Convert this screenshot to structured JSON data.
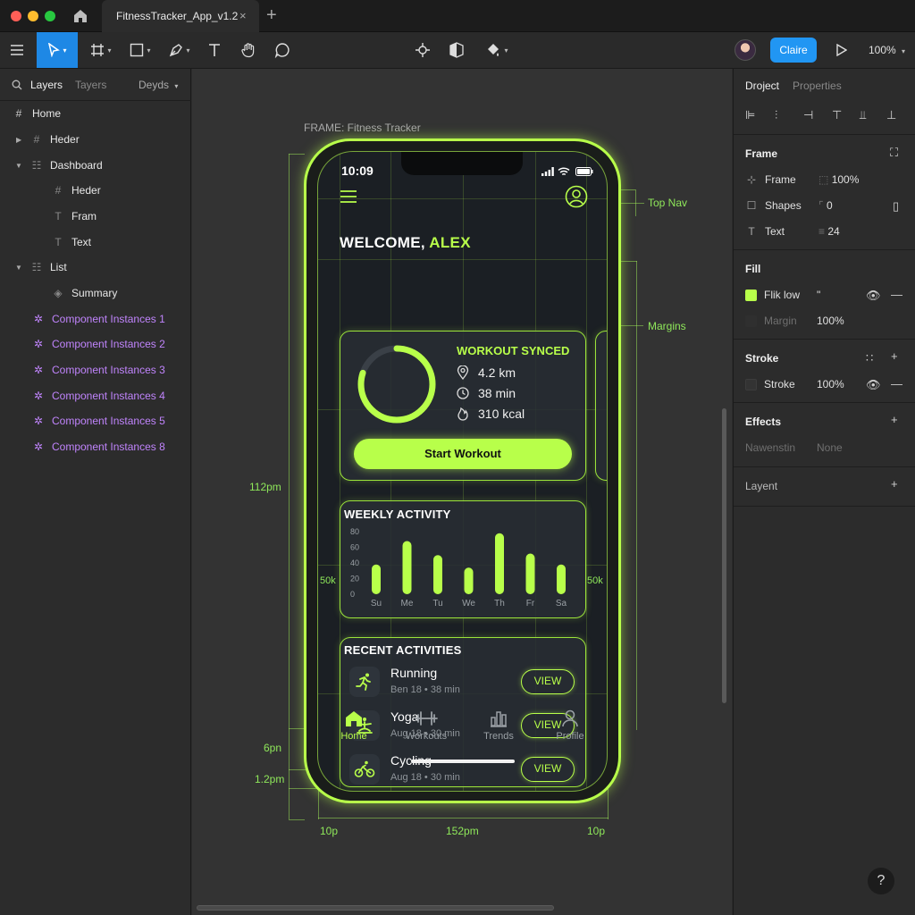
{
  "titlebar": {
    "tab_title": "FitnessTracker_App_v1.2",
    "close": "×",
    "plus": "+",
    "traffic_colors": [
      "#ff5f57",
      "#febc2e",
      "#28c840"
    ]
  },
  "toolbar": {
    "share_label": "Claire",
    "zoom": "100%",
    "icons": [
      "menu-icon",
      "move-tool-icon",
      "frame-tool-icon",
      "shape-tool-icon",
      "pen-tool-icon",
      "text-tool-icon",
      "hand-tool-icon",
      "comment-tool-icon",
      "component-icon",
      "mask-icon",
      "fill-icon",
      "play-icon"
    ]
  },
  "left_panel": {
    "tabs": [
      "Layers",
      "Tayers",
      "Deyds"
    ],
    "layers": [
      {
        "label": "Home",
        "icon": "frame-icon"
      },
      {
        "label": "Heder",
        "icon": "frame-icon"
      },
      {
        "label": "Dashboard",
        "icon": "grid-icon"
      },
      {
        "label": "Heder",
        "icon": "frame-icon"
      },
      {
        "label": "Fram",
        "icon": "text-icon"
      },
      {
        "label": "Text",
        "icon": "text-icon"
      },
      {
        "label": "List",
        "icon": "grid-icon"
      },
      {
        "label": "Summary",
        "icon": "layers-icon"
      },
      {
        "label": "Component Instances 1",
        "icon": "component-icon"
      },
      {
        "label": "Component Instances 2",
        "icon": "component-icon"
      },
      {
        "label": "Component Instances 3",
        "icon": "component-icon"
      },
      {
        "label": "Component Instances 4",
        "icon": "component-icon"
      },
      {
        "label": "Component Instances 5",
        "icon": "component-icon"
      },
      {
        "label": "Component Instances 8",
        "icon": "component-icon"
      }
    ]
  },
  "canvas": {
    "frame_label": "FRAME: Fitness Tracker",
    "annotations": {
      "top_nav": "Top Nav",
      "margins": "Margins",
      "height_112": "112pm",
      "h_6pn": "6pn",
      "h_12": "1.2pm",
      "w_left": "10p",
      "w_mid": "152pm",
      "w_right": "10p",
      "side_left": "50k",
      "side_right": "50k"
    }
  },
  "phone": {
    "time": "10:09",
    "welcome_prefix": "WELCOME, ",
    "welcome_name": "ALEX",
    "workout": {
      "title": "WORKOUT SYNCED",
      "distance": "4.2 km",
      "duration": "38 min",
      "calories": "310 kcal",
      "button": "Start Workout",
      "ring_progress": 0.8
    },
    "weekly": {
      "title": "WEEKLY ACTIVITY"
    },
    "recent": {
      "title": "RECENT ACTIVITIES",
      "items": [
        {
          "name": "Running",
          "meta": "Ben 18 • 38 min",
          "button": "VIEW",
          "icon": "running-icon"
        },
        {
          "name": "Yoga",
          "meta": "Aug 18 • 30 min",
          "button": "VIEW",
          "icon": "yoga-icon"
        },
        {
          "name": "Cycling",
          "meta": "Aug 18 • 30 min",
          "button": "VIEW",
          "icon": "cycling-icon"
        }
      ]
    },
    "nav": [
      {
        "label": "Home",
        "icon": "home-icon"
      },
      {
        "label": "Workouts",
        "icon": "dumbbell-icon"
      },
      {
        "label": "Trends",
        "icon": "bar-chart-icon"
      },
      {
        "label": "Profile",
        "icon": "user-icon"
      }
    ],
    "accent": "#b8ff4a"
  },
  "chart_data": {
    "type": "bar",
    "title": "WEEKLY ACTIVITY",
    "categories": [
      "Su",
      "Me",
      "Tu",
      "We",
      "Th",
      "Fr",
      "Sa"
    ],
    "values": [
      38,
      68,
      50,
      34,
      78,
      52,
      38
    ],
    "y_ticks": [
      "80",
      "60",
      "40",
      "20",
      "0"
    ],
    "ylim": [
      0,
      80
    ],
    "color": "#b8ff4a"
  },
  "right_panel": {
    "tabs": [
      "Droject",
      "Properties"
    ],
    "frame_section": {
      "title": "Frame",
      "rows": [
        {
          "label": "Frame",
          "value": "100%"
        },
        {
          "label": "Shapes",
          "value": "0"
        },
        {
          "label": "Text",
          "value": "24"
        }
      ]
    },
    "fill_section": {
      "title": "Fill",
      "swatch_label": "Flik low",
      "swatch_value": "\"",
      "swatch_color": "#b8ff4a",
      "margin_label": "Margin",
      "margin_value": "100%"
    },
    "stroke_section": {
      "title": "Stroke",
      "label": "Stroke",
      "value": "100%"
    },
    "effects_section": {
      "title": "Effects",
      "label": "Nawenstin",
      "value": "None"
    },
    "layout_section": {
      "title": "Layent"
    },
    "help": "?"
  }
}
